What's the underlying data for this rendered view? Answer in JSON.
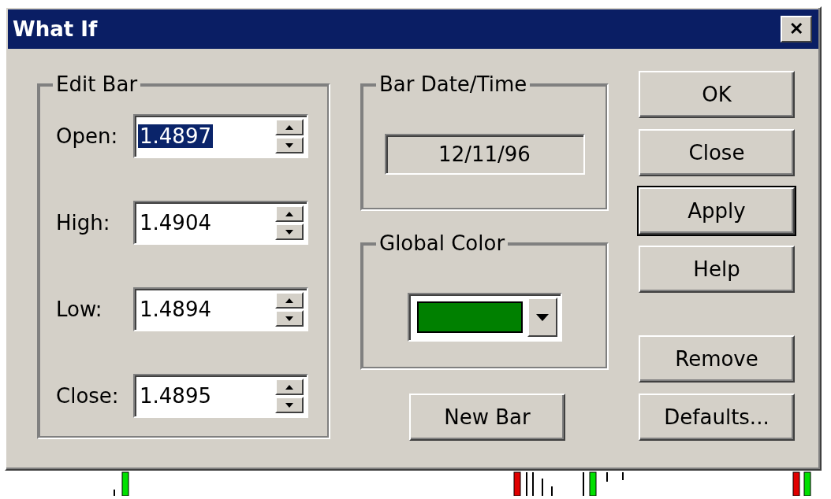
{
  "window": {
    "title": "What If",
    "close": "✕"
  },
  "edit_bar": {
    "title": "Edit Bar",
    "fields": [
      {
        "label": "Open:",
        "value": "1.4897",
        "selected": true
      },
      {
        "label": "High:",
        "value": "1.4904",
        "selected": false
      },
      {
        "label": "Low:",
        "value": "1.4894",
        "selected": false
      },
      {
        "label": "Close:",
        "value": "1.4895",
        "selected": false
      }
    ]
  },
  "bar_date_time": {
    "title": "Bar Date/Time",
    "value": "12/11/96"
  },
  "global_color": {
    "title": "Global Color",
    "color": "#008000"
  },
  "new_bar_button": {
    "label": "New Bar",
    "default": false
  },
  "buttons": [
    {
      "label": "OK",
      "default": false
    },
    {
      "label": "Close",
      "default": false
    },
    {
      "label": "Apply",
      "default": true
    },
    {
      "label": "Help",
      "default": false
    }
  ],
  "lower_buttons": [
    {
      "label": "Remove",
      "default": false
    },
    {
      "label": "Defaults...",
      "default": false
    }
  ]
}
